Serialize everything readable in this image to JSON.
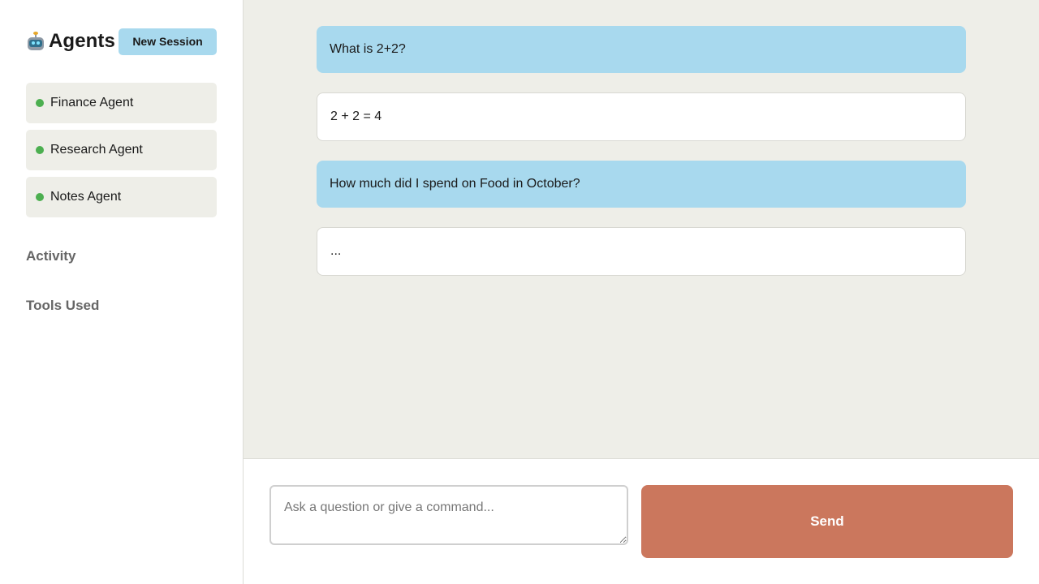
{
  "sidebar": {
    "title": "Agents",
    "new_session_label": "New Session",
    "agents": [
      {
        "label": "Finance Agent",
        "status_color": "#4caf50"
      },
      {
        "label": "Research Agent",
        "status_color": "#4caf50"
      },
      {
        "label": "Notes Agent",
        "status_color": "#4caf50"
      }
    ],
    "activity_label": "Activity",
    "tools_label": "Tools Used"
  },
  "chat": {
    "messages": [
      {
        "role": "user",
        "text": "What is 2+2?"
      },
      {
        "role": "assistant",
        "text": "2 + 2 = 4"
      },
      {
        "role": "user",
        "text": "How much did I spend on Food in October?"
      },
      {
        "role": "assistant",
        "text": "..."
      }
    ]
  },
  "composer": {
    "input_value": "",
    "input_placeholder": "Ask a question or give a command...",
    "send_label": "Send"
  },
  "colors": {
    "accent_blue": "#a8d9ee",
    "send_button": "#cb775d",
    "status_online": "#4caf50",
    "chat_background": "#eeeee8"
  },
  "icons": {
    "brand": "robot-icon"
  }
}
